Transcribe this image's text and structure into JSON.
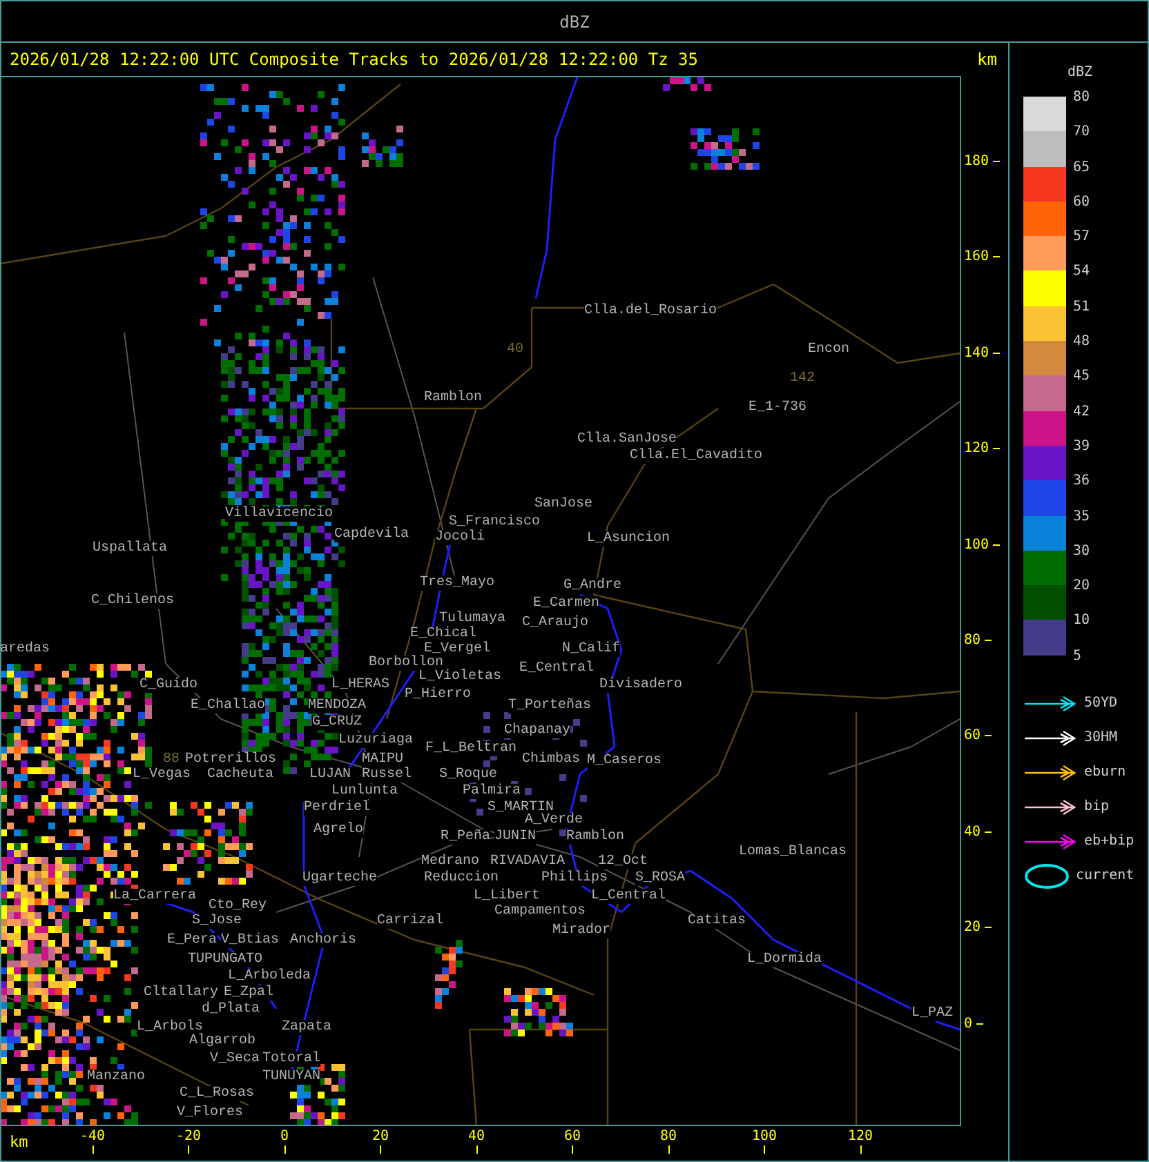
{
  "window": {
    "title": "dBZ"
  },
  "header": {
    "text": "2026/01/28 12:22:00 UTC Composite Tracks to 2026/01/28 12:22:00 Tz 35",
    "unit": "km"
  },
  "map": {
    "places": [
      {
        "kind": "place",
        "name": "Clla.del_Rosario"
      },
      {
        "kind": "route",
        "name": "40"
      },
      {
        "kind": "place",
        "name": "Encon"
      },
      {
        "kind": "route",
        "name": "142"
      },
      {
        "kind": "place",
        "name": "Ramblon"
      },
      {
        "kind": "place",
        "name": "E_1-736"
      },
      {
        "kind": "place",
        "name": "Clla.SanJose"
      },
      {
        "kind": "place",
        "name": "Clla.El_Cavadito"
      },
      {
        "kind": "place",
        "name": "SanJose"
      },
      {
        "kind": "place",
        "name": "Villavicencio"
      },
      {
        "kind": "place",
        "name": "S_Francisco"
      },
      {
        "kind": "place",
        "name": "Capdevila"
      },
      {
        "kind": "place",
        "name": "Jocoli"
      },
      {
        "kind": "place",
        "name": "L_Asuncion"
      },
      {
        "kind": "place",
        "name": "Uspallata"
      },
      {
        "kind": "place",
        "name": "Tres_Mayo"
      },
      {
        "kind": "place",
        "name": "G_Andre"
      },
      {
        "kind": "place",
        "name": "C_Chilenos"
      },
      {
        "kind": "place",
        "name": "E_Carmen"
      },
      {
        "kind": "place",
        "name": "Tulumaya"
      },
      {
        "kind": "place",
        "name": "C_Araujo"
      },
      {
        "kind": "place",
        "name": "E_Chical"
      },
      {
        "kind": "place",
        "name": "aredas"
      },
      {
        "kind": "place",
        "name": "E_Vergel"
      },
      {
        "kind": "place",
        "name": "N_Calif"
      },
      {
        "kind": "place",
        "name": "Borbollon"
      },
      {
        "kind": "place",
        "name": "E_Central"
      },
      {
        "kind": "place",
        "name": "L_Violetas"
      },
      {
        "kind": "place",
        "name": "C_Guido"
      },
      {
        "kind": "place",
        "name": "L_HERAS"
      },
      {
        "kind": "place",
        "name": "Divisadero"
      },
      {
        "kind": "place",
        "name": "P_Hierro"
      },
      {
        "kind": "place",
        "name": "E_Challao"
      },
      {
        "kind": "place",
        "name": "MENDOZA"
      },
      {
        "kind": "place",
        "name": "T_Porteñas"
      },
      {
        "kind": "place",
        "name": "G_CRUZ"
      },
      {
        "kind": "place",
        "name": "Chapanay"
      },
      {
        "kind": "place",
        "name": "Luzuriaga"
      },
      {
        "kind": "place",
        "name": "F_L_Beltran"
      },
      {
        "kind": "route",
        "name": "88"
      },
      {
        "kind": "place",
        "name": "Potrerillos"
      },
      {
        "kind": "place",
        "name": "MAIPU"
      },
      {
        "kind": "place",
        "name": "Chimbas"
      },
      {
        "kind": "place",
        "name": "M_Caseros"
      },
      {
        "kind": "place",
        "name": "L_Vegas"
      },
      {
        "kind": "place",
        "name": "Cacheuta"
      },
      {
        "kind": "place",
        "name": "LUJAN"
      },
      {
        "kind": "place",
        "name": "Russel"
      },
      {
        "kind": "place",
        "name": "S_Roque"
      },
      {
        "kind": "place",
        "name": "Lunlunta"
      },
      {
        "kind": "place",
        "name": "Palmira"
      },
      {
        "kind": "place",
        "name": "Perdriel"
      },
      {
        "kind": "place",
        "name": "S_MARTIN"
      },
      {
        "kind": "place",
        "name": "A_Verde"
      },
      {
        "kind": "place",
        "name": "Agrelo"
      },
      {
        "kind": "place",
        "name": "R_Peña"
      },
      {
        "kind": "place",
        "name": "JUNIN"
      },
      {
        "kind": "place",
        "name": "Ramblon"
      },
      {
        "kind": "place",
        "name": "Lomas_Blancas"
      },
      {
        "kind": "place",
        "name": "Medrano"
      },
      {
        "kind": "place",
        "name": "RIVADAVIA"
      },
      {
        "kind": "place",
        "name": "12_Oct"
      },
      {
        "kind": "place",
        "name": "Ugarteche"
      },
      {
        "kind": "place",
        "name": "Reduccion"
      },
      {
        "kind": "place",
        "name": "Phillips"
      },
      {
        "kind": "place",
        "name": "S_ROSA"
      },
      {
        "kind": "place",
        "name": "La_Carrera"
      },
      {
        "kind": "place",
        "name": "L_Libert"
      },
      {
        "kind": "place",
        "name": "L_Central"
      },
      {
        "kind": "place",
        "name": "Cto_Rey"
      },
      {
        "kind": "place",
        "name": "Campamentos"
      },
      {
        "kind": "place",
        "name": "S_Jose"
      },
      {
        "kind": "place",
        "name": "Carrizal"
      },
      {
        "kind": "place",
        "name": "Catitas"
      },
      {
        "kind": "place",
        "name": "Mirador"
      },
      {
        "kind": "place",
        "name": "E_Pera"
      },
      {
        "kind": "place",
        "name": "V_Btias"
      },
      {
        "kind": "place",
        "name": "Anchoris"
      },
      {
        "kind": "place",
        "name": "TUPUNGATO"
      },
      {
        "kind": "place",
        "name": "L_Dormida"
      },
      {
        "kind": "place",
        "name": "L_Arboleda"
      },
      {
        "kind": "place",
        "name": "Cltallary"
      },
      {
        "kind": "place",
        "name": "E_Zpal"
      },
      {
        "kind": "place",
        "name": "d_Plata"
      },
      {
        "kind": "place",
        "name": "L_PAZ"
      },
      {
        "kind": "place",
        "name": "L_Arbols"
      },
      {
        "kind": "place",
        "name": "Zapata"
      },
      {
        "kind": "place",
        "name": "Algarrob"
      },
      {
        "kind": "place",
        "name": "V_Seca"
      },
      {
        "kind": "place",
        "name": "Totoral"
      },
      {
        "kind": "place",
        "name": "Manzano"
      },
      {
        "kind": "place",
        "name": "TUNUYAN"
      },
      {
        "kind": "place",
        "name": "C_L_Rosas"
      },
      {
        "kind": "place",
        "name": "V_Flores"
      }
    ]
  },
  "y_axis": {
    "ticks": [
      "180",
      "160",
      "140",
      "120",
      "100",
      "80",
      "60",
      "40",
      "20",
      "0"
    ]
  },
  "x_axis": {
    "unit": "km",
    "ticks": [
      "-40",
      "-20",
      "0",
      "20",
      "40",
      "60",
      "80",
      "100",
      "120"
    ]
  },
  "scale": {
    "title": "dBZ",
    "bottom_label": "5",
    "bands": [
      {
        "label": "80",
        "color": "#d9d9d9"
      },
      {
        "label": "70",
        "color": "#bdbdbd"
      },
      {
        "label": "65",
        "color": "#f5381f"
      },
      {
        "label": "60",
        "color": "#ff6408"
      },
      {
        "label": "57",
        "color": "#ff9a5a"
      },
      {
        "label": "54",
        "color": "#ffff00"
      },
      {
        "label": "51",
        "color": "#fbc233"
      },
      {
        "label": "48",
        "color": "#d18a3e"
      },
      {
        "label": "45",
        "color": "#c46a8c"
      },
      {
        "label": "42",
        "color": "#cc1488"
      },
      {
        "label": "39",
        "color": "#6a14c8"
      },
      {
        "label": "36",
        "color": "#1e46e6"
      },
      {
        "label": "35",
        "color": "#0a82dc"
      },
      {
        "label": "30",
        "color": "#006e00"
      },
      {
        "label": "20",
        "color": "#005000"
      },
      {
        "label": "10",
        "color": "#463c8c"
      }
    ]
  },
  "tracks": [
    {
      "kind": "arrow",
      "label": "50YD",
      "color": "#00e5ee"
    },
    {
      "kind": "arrow",
      "label": "30HM",
      "color": "#ffffff"
    },
    {
      "kind": "arrow",
      "label": "eburn",
      "color": "#ffc000"
    },
    {
      "kind": "arrow",
      "label": "bip",
      "color": "#ffc0cb"
    },
    {
      "kind": "arrow",
      "label": "eb+bip",
      "color": "#ff00ff"
    },
    {
      "kind": "ellipse",
      "label": "current",
      "color": "#00e5ee"
    }
  ]
}
